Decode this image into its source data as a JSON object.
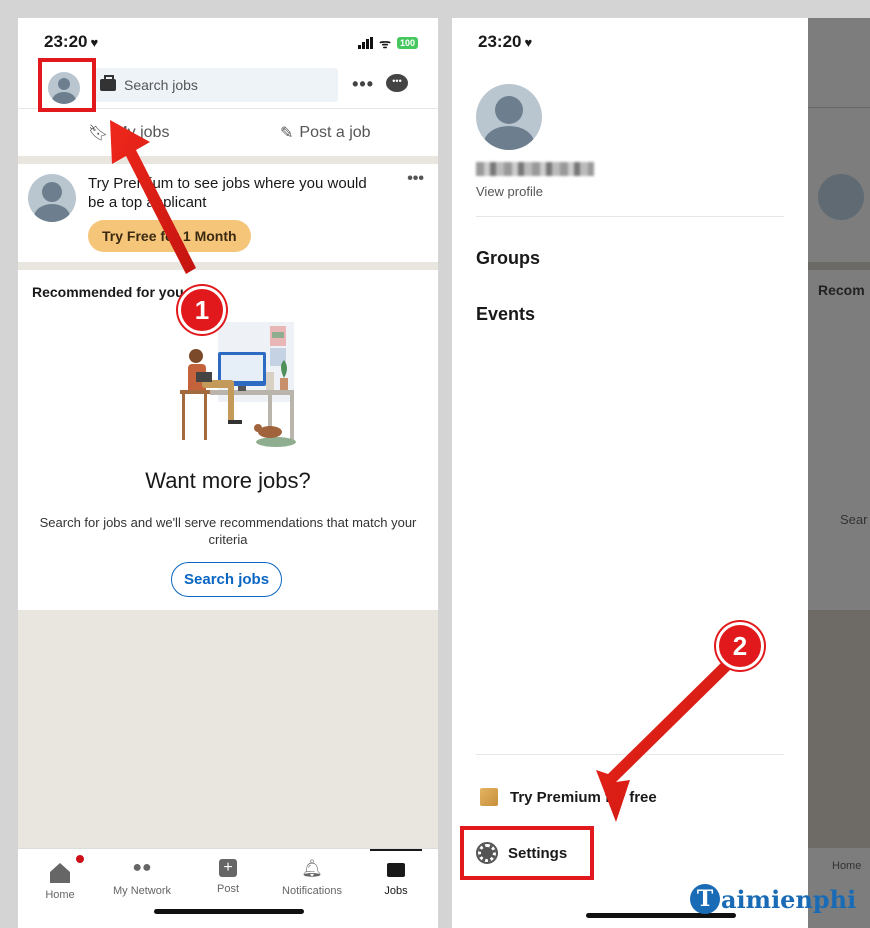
{
  "status": {
    "time": "23:20",
    "battery": "100"
  },
  "left": {
    "search_placeholder": "Search jobs",
    "more": "•••",
    "subnav": {
      "my_jobs": "My jobs",
      "post_job": "Post a job"
    },
    "premium": {
      "text": "Try Premium to see jobs where you would be a top applicant",
      "button": "Try Free for 1 Month",
      "more": "•••"
    },
    "recommended_title": "Recommended for you",
    "empty_title": "Want more jobs?",
    "empty_desc": "Search for jobs and we'll serve recommendations that match your criteria",
    "search_button": "Search jobs",
    "nav": [
      "Home",
      "My Network",
      "Post",
      "Notifications",
      "Jobs"
    ]
  },
  "right": {
    "view_profile": "View profile",
    "menu": [
      "Groups",
      "Events"
    ],
    "premium": "Try Premium for free",
    "settings": "Settings",
    "dim_text": {
      "rec": "Recom",
      "search": "Sear",
      "home": "Home"
    }
  },
  "annotations": {
    "step1": "1",
    "step2": "2",
    "color": "#e2191c"
  },
  "watermark": {
    "logo": "T",
    "text": "aimienphi"
  },
  "colors": {
    "linkedin_blue": "#0a66c2",
    "premium_gold": "#f5c57a",
    "feed_bg": "#e9e5df"
  }
}
